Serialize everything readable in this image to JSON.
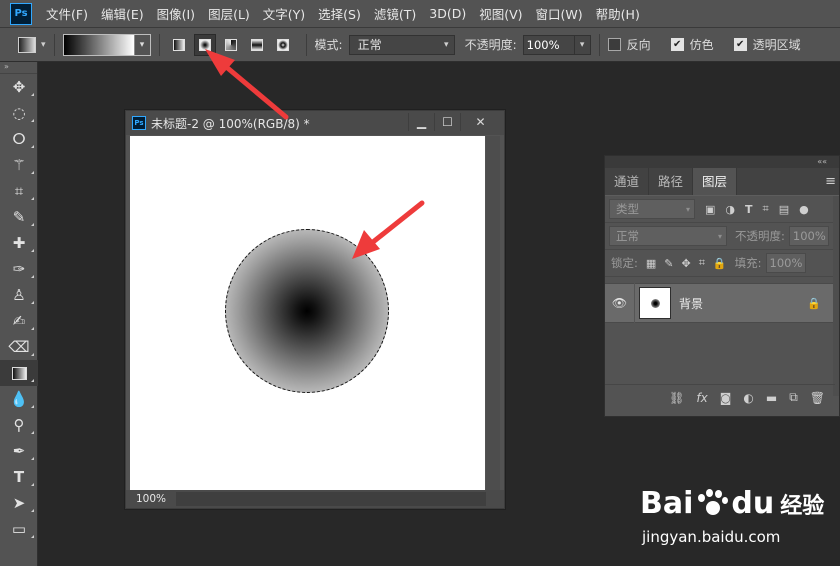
{
  "app": {
    "logo": "Ps",
    "menu": [
      "文件(F)",
      "编辑(E)",
      "图像(I)",
      "图层(L)",
      "文字(Y)",
      "选择(S)",
      "滤镜(T)",
      "3D(D)",
      "视图(V)",
      "窗口(W)",
      "帮助(H)"
    ]
  },
  "options": {
    "mode_label": "模式:",
    "mode_value": "正常",
    "opacity_label": "不透明度:",
    "opacity_value": "100%",
    "reverse_label": "反向",
    "reverse_checked": false,
    "dither_label": "仿色",
    "dither_checked": true,
    "transparency_label": "透明区域",
    "transparency_checked": true,
    "active_gradient_type": "radial"
  },
  "toolbar": {
    "collapse": "»",
    "tools": [
      "move-tool",
      "elliptical-marquee-tool",
      "lasso-tool",
      "magic-wand-tool",
      "crop-tool",
      "eyedropper-tool",
      "healing-brush-tool",
      "brush-tool",
      "clone-stamp-tool",
      "history-brush-tool",
      "eraser-tool",
      "gradient-tool",
      "blur-tool",
      "dodge-tool",
      "pen-tool",
      "type-tool",
      "path-selection-tool",
      "rectangle-tool"
    ],
    "active": "gradient-tool"
  },
  "document": {
    "logo": "Ps",
    "title": "未标题-2 @ 100%(RGB/8) *",
    "zoom": "100%",
    "minimize": "▁",
    "maximize": "☐",
    "close": "✕"
  },
  "layers_panel": {
    "collapse": "««",
    "tabs": [
      "通道",
      "路径",
      "图层"
    ],
    "active_tab": "图层",
    "menu": "≡",
    "filter_placeholder": "类型",
    "blend_mode": "正常",
    "opacity_label": "不透明度:",
    "opacity_value": "100%",
    "lock_label": "锁定:",
    "fill_label": "填充:",
    "fill_value": "100%",
    "layer_name": "背景",
    "bottom_icons": [
      "link-icon",
      "fx-icon",
      "mask-icon",
      "adjustment-icon",
      "folder-icon",
      "new-layer-icon",
      "trash-icon"
    ]
  },
  "watermark": {
    "brand": "Bai",
    "brand_du": "du",
    "brand_cn": "经验",
    "url": "jingyan.baidu.com"
  },
  "colors": {
    "ui_bg": "#535353",
    "workspace": "#282828",
    "arrow": "#ee3b3b",
    "ps_blue": "#31a8ff"
  }
}
